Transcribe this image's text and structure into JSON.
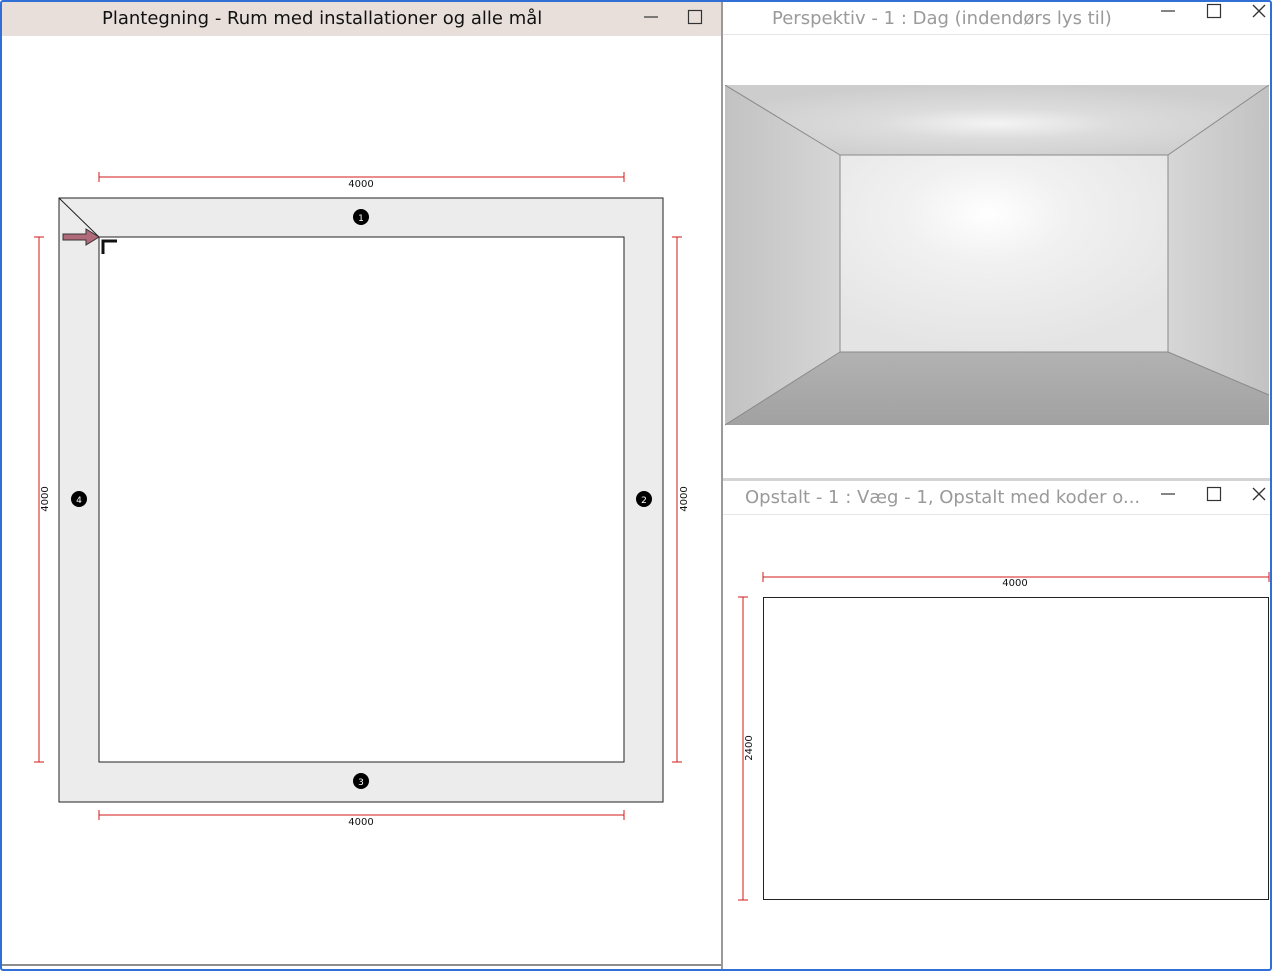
{
  "plan": {
    "title": "Plantegning - Rum med installationer og alle mål",
    "dim_top": "4000",
    "dim_bottom": "4000",
    "dim_left": "4000",
    "dim_right": "4000",
    "wall_labels": [
      "1",
      "2",
      "3",
      "4"
    ]
  },
  "perspective": {
    "title": "Perspektiv - 1 : Dag (indendørs lys til)"
  },
  "elevation": {
    "title": "Opstalt - 1 : Væg - 1, Opstalt med koder o...",
    "dim_width": "4000",
    "dim_height": "2400"
  },
  "colors": {
    "plan_titlebar_bg": "#e8dfdb",
    "dimension_red": "#d11a1a",
    "wall_fill": "#ececec",
    "arrow_fill": "#b06a7a",
    "inactive_title": "#9a9a9a"
  },
  "icons": {
    "minimize": "minimize-icon",
    "maximize": "maximize-icon",
    "close": "close-icon",
    "arrow": "entrance-arrow-icon"
  }
}
